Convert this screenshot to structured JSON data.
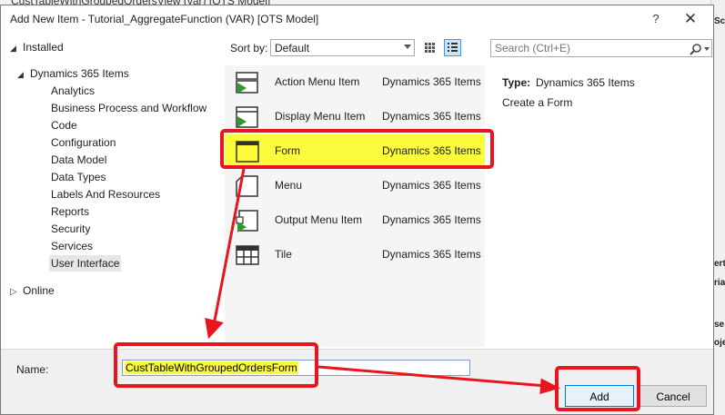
{
  "background_window": {
    "title_fragment": "CustTableWithGroupedOrdersView (var) [OTS Model]"
  },
  "dialog": {
    "title": "Add New Item - Tutorial_AggregateFunction (VAR) [OTS Model]",
    "help_label": "?",
    "close_label": "✕"
  },
  "tree": {
    "installed": "Installed",
    "root": "Dynamics 365 Items",
    "items": [
      "Analytics",
      "Business Process and Workflow",
      "Code",
      "Configuration",
      "Data Model",
      "Data Types",
      "Labels And Resources",
      "Reports",
      "Security",
      "Services",
      "User Interface"
    ],
    "selected": "User Interface",
    "online": "Online"
  },
  "sort": {
    "label": "Sort by:",
    "value": "Default"
  },
  "search": {
    "placeholder": "Search (Ctrl+E)"
  },
  "list": {
    "items": [
      {
        "name": "Action Menu Item",
        "category": "Dynamics 365 Items",
        "icon": "action-menu-item-icon"
      },
      {
        "name": "Display Menu Item",
        "category": "Dynamics 365 Items",
        "icon": "display-menu-item-icon"
      },
      {
        "name": "Form",
        "category": "Dynamics 365 Items",
        "icon": "form-icon"
      },
      {
        "name": "Menu",
        "category": "Dynamics 365 Items",
        "icon": "menu-icon"
      },
      {
        "name": "Output Menu Item",
        "category": "Dynamics 365 Items",
        "icon": "output-menu-item-icon"
      },
      {
        "name": "Tile",
        "category": "Dynamics 365 Items",
        "icon": "tile-icon"
      }
    ],
    "selected": "Form"
  },
  "detail": {
    "type_label": "Type:",
    "type_value": "Dynamics 365 Items",
    "description": "Create a Form"
  },
  "name_field": {
    "label": "Name:",
    "value": "CustTableWithGroupedOrdersForm"
  },
  "buttons": {
    "add": "Add",
    "cancel": "Cancel"
  },
  "colors": {
    "highlight": "#fbfb3b",
    "annotation": "#e8141e",
    "play_arrow": "#2e9a2e",
    "accent": "#0078d7"
  }
}
